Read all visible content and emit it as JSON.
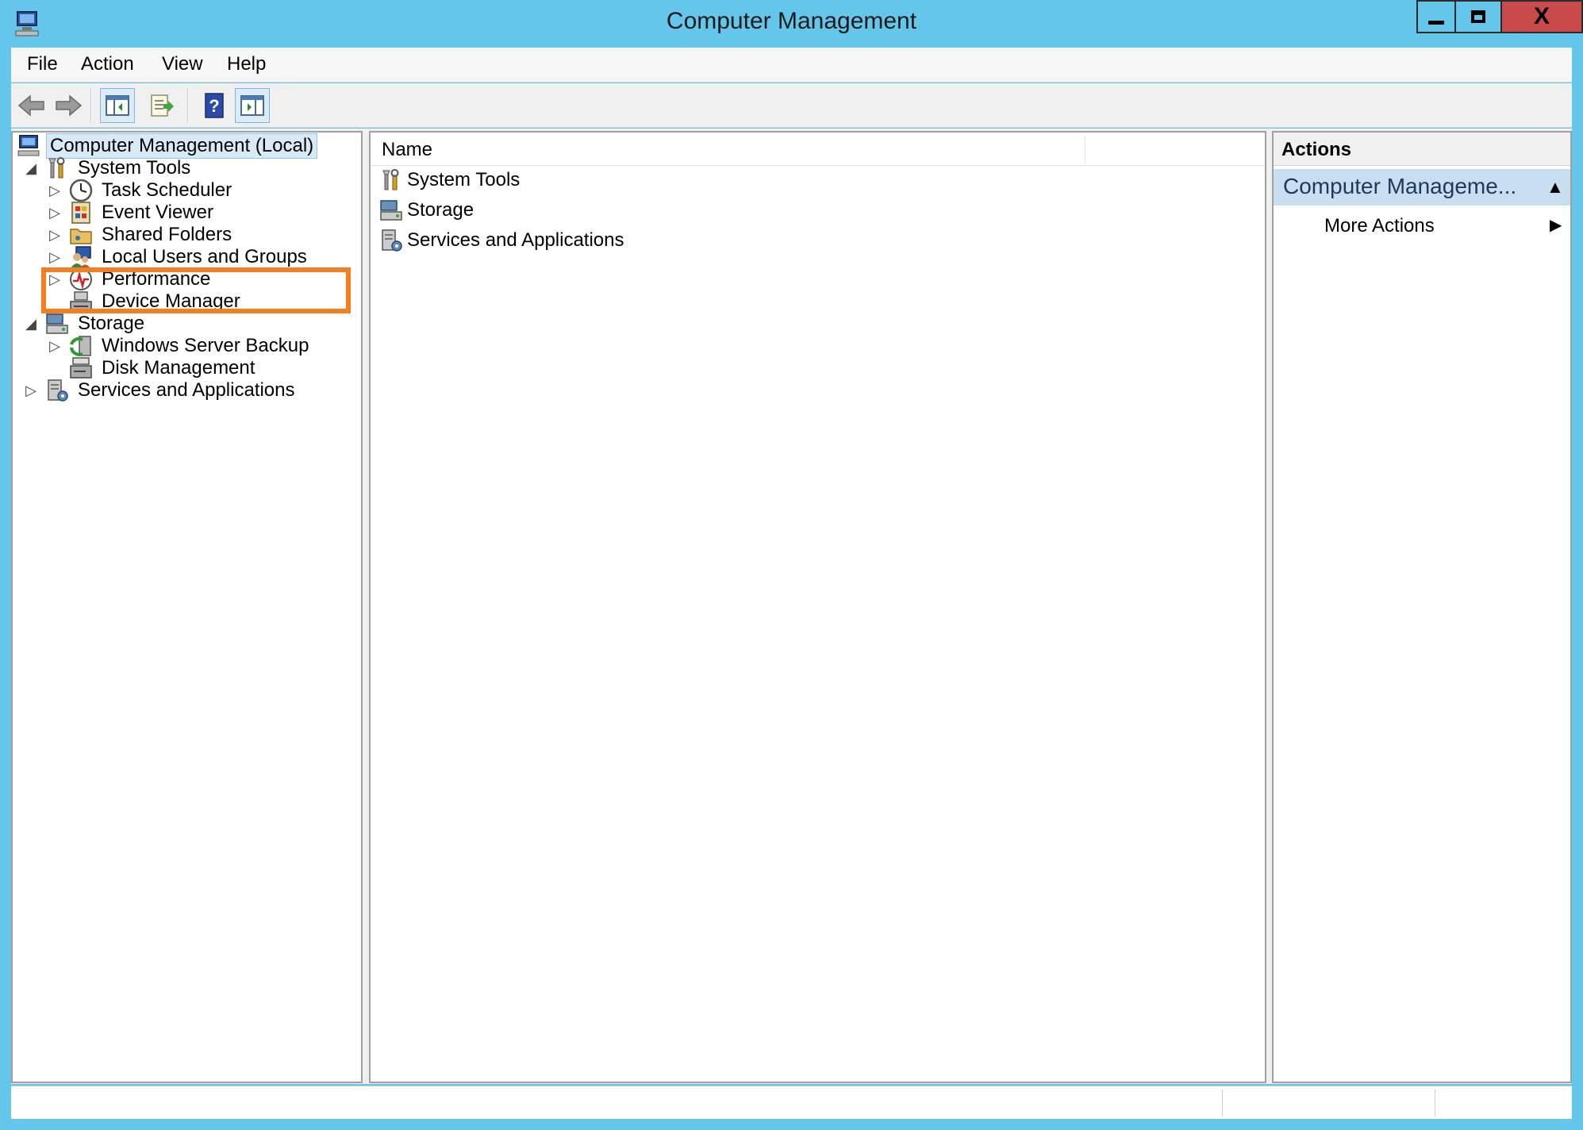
{
  "window": {
    "title": "Computer Management",
    "icon": "computer-management-icon",
    "controls": {
      "minimize": "minimize-icon",
      "maximize": "maximize-icon",
      "close_label": "X"
    }
  },
  "menu": {
    "items": [
      {
        "label": "File"
      },
      {
        "label": "Action"
      },
      {
        "label": "View"
      },
      {
        "label": "Help"
      }
    ]
  },
  "toolbar": {
    "buttons": [
      {
        "icon": "back-arrow-icon"
      },
      {
        "icon": "forward-arrow-icon"
      },
      {
        "icon": "show-hide-console-tree-icon"
      },
      {
        "icon": "export-list-icon"
      },
      {
        "icon": "help-icon",
        "glyph": "?"
      },
      {
        "icon": "show-hide-action-pane-icon"
      }
    ]
  },
  "tree": {
    "root": {
      "label": "Computer Management (Local)",
      "icon": "computer-management-icon",
      "selected": true
    },
    "items": [
      {
        "label": "System Tools",
        "icon": "system-tools-icon",
        "expander": "◢"
      },
      {
        "label": "Task Scheduler",
        "icon": "task-scheduler-icon",
        "expander": "▷"
      },
      {
        "label": "Event Viewer",
        "icon": "event-viewer-icon",
        "expander": "▷"
      },
      {
        "label": "Shared Folders",
        "icon": "shared-folders-icon",
        "expander": "▷"
      },
      {
        "label": "Local Users and Groups",
        "icon": "local-users-groups-icon",
        "expander": "▷",
        "highlighted": true
      },
      {
        "label": "Performance",
        "icon": "performance-icon",
        "expander": "▷"
      },
      {
        "label": "Device Manager",
        "icon": "device-manager-icon",
        "expander": ""
      },
      {
        "label": "Storage",
        "icon": "storage-icon",
        "expander": "◢"
      },
      {
        "label": "Windows Server Backup",
        "icon": "windows-server-backup-icon",
        "expander": "▷"
      },
      {
        "label": "Disk Management",
        "icon": "disk-management-icon",
        "expander": ""
      },
      {
        "label": "Services and Applications",
        "icon": "services-applications-icon",
        "expander": "▷"
      }
    ]
  },
  "list": {
    "column_header": "Name",
    "rows": [
      {
        "label": "System Tools",
        "icon": "system-tools-icon"
      },
      {
        "label": "Storage",
        "icon": "storage-icon"
      },
      {
        "label": "Services and Applications",
        "icon": "services-applications-icon"
      }
    ]
  },
  "actions": {
    "title": "Actions",
    "section_label": "Computer Manageme...",
    "collapse_glyph": "▲",
    "more_actions_label": "More Actions",
    "more_actions_glyph": "▶"
  },
  "colors": {
    "window_frame": "#63c6ea",
    "highlight_box": "#f57f20",
    "actions_section": "#c9dff1",
    "close_button": "#c94a4a"
  }
}
